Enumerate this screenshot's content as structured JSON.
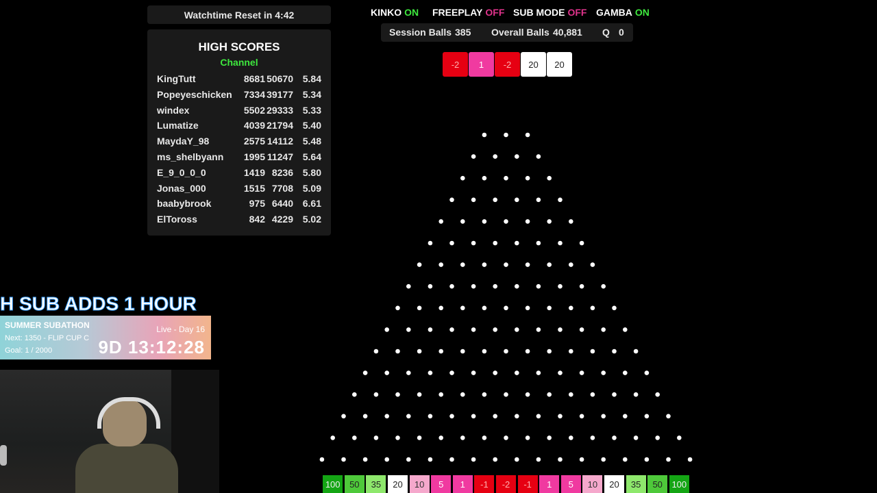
{
  "watchtime": "Watchtime Reset in  4:42",
  "high_scores": {
    "title": "HIGH SCORES",
    "subtitle": "Channel",
    "rows": [
      {
        "name": "KingTutt",
        "a": "8681",
        "b": "50670",
        "c": "5.84"
      },
      {
        "name": "Popeyeschicken",
        "a": "7334",
        "b": "39177",
        "c": "5.34"
      },
      {
        "name": "windex",
        "a": "5502",
        "b": "29333",
        "c": "5.33"
      },
      {
        "name": "Lumatize",
        "a": "4039",
        "b": "21794",
        "c": "5.40"
      },
      {
        "name": "MaydaY_98",
        "a": "2575",
        "b": "14112",
        "c": "5.48"
      },
      {
        "name": "ms_shelbyann",
        "a": "1995",
        "b": "11247",
        "c": "5.64"
      },
      {
        "name": "E_9_0_0_0",
        "a": "1419",
        "b": "8236",
        "c": "5.80"
      },
      {
        "name": "Jonas_000",
        "a": "1515",
        "b": "7708",
        "c": "5.09"
      },
      {
        "name": "baabybrook",
        "a": "975",
        "b": "6440",
        "c": "6.61"
      },
      {
        "name": "ElToross",
        "a": "842",
        "b": "4229",
        "c": "5.02"
      }
    ]
  },
  "modes": [
    {
      "label": "KINKO",
      "state": "ON"
    },
    {
      "label": "FREEPLAY",
      "state": "OFF"
    },
    {
      "label": "SUB MODE",
      "state": "OFF"
    },
    {
      "label": "GAMBA",
      "state": "ON"
    }
  ],
  "stats": {
    "session_label": "Session Balls",
    "session_value": "385",
    "overall_label": "Overall Balls",
    "overall_value": "40,881",
    "queue_label": "Q",
    "queue_value": "0"
  },
  "recent_results": [
    {
      "value": "-2",
      "color": "red"
    },
    {
      "value": "1",
      "color": "pink"
    },
    {
      "value": "-2",
      "color": "red"
    },
    {
      "value": "20",
      "color": "white"
    },
    {
      "value": "20",
      "color": "white"
    }
  ],
  "slots": [
    {
      "value": "100",
      "color": "dgreen"
    },
    {
      "value": "50",
      "color": "green"
    },
    {
      "value": "35",
      "color": "lgreen"
    },
    {
      "value": "20",
      "color": "white"
    },
    {
      "value": "10",
      "color": "lpink"
    },
    {
      "value": "5",
      "color": "pink"
    },
    {
      "value": "1",
      "color": "pink"
    },
    {
      "value": "-1",
      "color": "red"
    },
    {
      "value": "-2",
      "color": "red"
    },
    {
      "value": "-1",
      "color": "red"
    },
    {
      "value": "1",
      "color": "pink"
    },
    {
      "value": "5",
      "color": "pink"
    },
    {
      "value": "10",
      "color": "lpink"
    },
    {
      "value": "20",
      "color": "white"
    },
    {
      "value": "35",
      "color": "lgreen"
    },
    {
      "value": "50",
      "color": "green"
    },
    {
      "value": "100",
      "color": "dgreen"
    }
  ],
  "subathon": {
    "banner": "H SUB ADDS 1 HOUR",
    "title": "SUMMER SUBATHON",
    "next": "Next: 1350 - FLIP CUP C",
    "goal": "Goal: 1 / 2000",
    "live": "Live - Day 16",
    "timer": "9D 13:12:28"
  },
  "peg_rows": 16,
  "colors": {
    "on": "#3ee83e",
    "off": "#e0338c",
    "background": "#000000",
    "panel": "#1a1a1a"
  }
}
